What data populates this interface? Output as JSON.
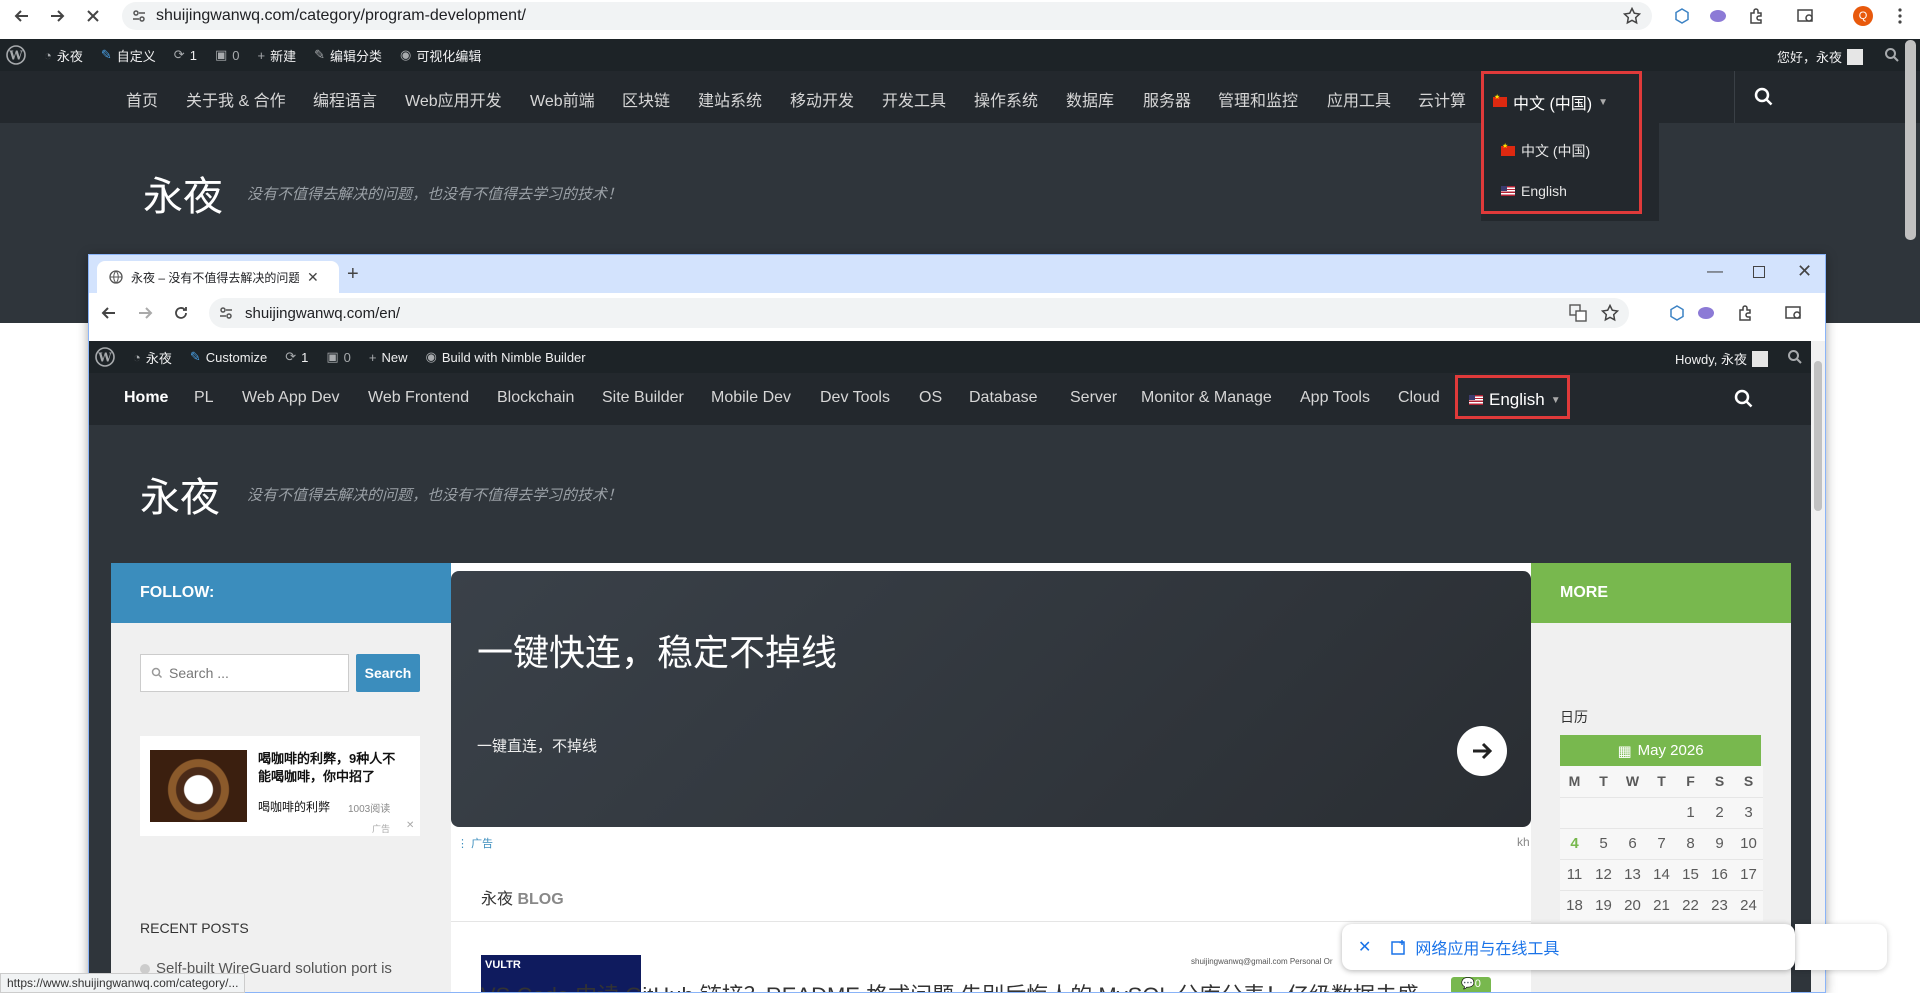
{
  "outer_browser": {
    "url": "shuijingwanwq.com/category/program-development/",
    "avatar_letter": "Q"
  },
  "outer_adminbar": {
    "site_name": "永夜",
    "customize": "自定义",
    "updates_count": "1",
    "comments_count": "0",
    "new": "新建",
    "edit_category": "编辑分类",
    "visual_edit": "可视化编辑",
    "howdy": "您好，永夜"
  },
  "outer_nav": {
    "items": [
      "首页",
      "关于我 & 合作",
      "编程语言",
      "Web应用开发",
      "Web前端",
      "区块链",
      "建站系统",
      "移动开发",
      "开发工具",
      "操作系统",
      "数据库",
      "服务器",
      "管理和监控",
      "应用工具",
      "云计算"
    ],
    "lang_current": "中文 (中国)",
    "dropdown": [
      "中文 (中国)",
      "English"
    ]
  },
  "outer_hero": {
    "title": "永夜",
    "tagline": "没有不值得去解决的问题，也没有不值得去学习的技术！"
  },
  "inner_browser": {
    "tab_title": "永夜 – 没有不值得去解决的问题",
    "url": "shuijingwanwq.com/en/",
    "avatar_letter": "Q"
  },
  "inner_adminbar": {
    "site_name": "永夜",
    "customize": "Customize",
    "updates_count": "1",
    "comments_count": "0",
    "new": "New",
    "nimble": "Build with Nimble Builder",
    "howdy": "Howdy, 永夜"
  },
  "inner_nav": {
    "items": [
      "Home",
      "PL",
      "Web App Dev",
      "Web Frontend",
      "Blockchain",
      "Site Builder",
      "Mobile Dev",
      "Dev Tools",
      "OS",
      "Database",
      "Server",
      "Monitor & Manage",
      "App Tools",
      "Cloud"
    ],
    "lang_current": "English"
  },
  "inner_hero": {
    "title": "永夜",
    "tagline": "没有不值得去解决的问题，也没有不值得去学习的技术！"
  },
  "left_sidebar": {
    "follow": "FOLLOW:",
    "search_placeholder": "Search ...",
    "search_button": "Search",
    "ad_title": "喝咖啡的利弊，9种人不能喝咖啡，你中招了",
    "ad_sub": "喝咖啡的利弊",
    "ad_reads": "1003阅读",
    "ad_mark": "广告",
    "recent_posts": "RECENT POSTS",
    "recent_first": "Self-built WireGuard solution port is"
  },
  "main": {
    "banner_title": "一键快连，稳定不掉线",
    "banner_sub": "一键直连，不掉线",
    "ad_label": "广告",
    "ad_corner": "kh",
    "blog_prefix": "永夜",
    "blog_label": "BLOG",
    "thumb_brand": "VULTR",
    "thumb_right": "shuijingwanwq@gmail.com Personal Or",
    "posts_bottom": "VS Code 中读 GitHub 链接？README 格式问题 先别后悔人的 MySQL 分库分表！亿级数据去盛",
    "comment_count": "0"
  },
  "right_sidebar": {
    "more": "MORE",
    "calendar_heading": "日历",
    "calendar_month": "May 2026",
    "weekdays": [
      "M",
      "T",
      "W",
      "T",
      "F",
      "S",
      "S"
    ],
    "weeks": [
      [
        "",
        "",
        "",
        "",
        "1",
        "2",
        "3"
      ],
      [
        "4",
        "5",
        "6",
        "7",
        "8",
        "9",
        "10"
      ],
      [
        "11",
        "12",
        "13",
        "14",
        "15",
        "16",
        "17"
      ],
      [
        "18",
        "19",
        "20",
        "21",
        "22",
        "23",
        "24"
      ]
    ],
    "today": "4"
  },
  "toast": {
    "text": "网络应用与在线工具"
  },
  "status_bar": {
    "url": "https://www.shuijingwanwq.com/category/..."
  },
  "colors": {
    "admin_bar": "#1d2327",
    "nav_bg": "#23282d",
    "hero_bg": "#2f353b",
    "follow_blue": "#3b8dbd",
    "more_green": "#78b84e",
    "highlight_red": "#e03a3a"
  }
}
